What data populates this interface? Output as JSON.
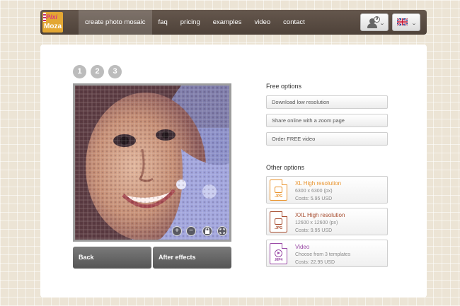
{
  "header": {
    "logo_top": "Pixi",
    "logo_bottom": "Moza",
    "nav": [
      "create photo mosaic",
      "faq",
      "pricing",
      "examples",
      "video",
      "contact"
    ],
    "user_badge": "0",
    "user_chevron": "⌄",
    "lang_chevron": "⌄"
  },
  "steps": [
    "1",
    "2",
    "3"
  ],
  "mosaic_controls": {
    "zoom_in": "+",
    "zoom_out": "−"
  },
  "buttons": {
    "back": "Back",
    "after_effects": "After effects"
  },
  "free_options": {
    "heading": "Free options",
    "items": [
      "Download low resolution",
      "Share online with a zoom page",
      "Order FREE video"
    ]
  },
  "other_options": {
    "heading": "Other options",
    "items": [
      {
        "ext": ".JPG",
        "title": "XL High resolution",
        "line1": "6300 x 6300 (px)",
        "line2": "Costs: 5.95 USD",
        "color": "#e9922a"
      },
      {
        "ext": ".JPG",
        "title": "XXL High resolution",
        "line1": "12600 x 12600 (px)",
        "line2": "Costs: 9.95 USD",
        "color": "#a64a2c"
      },
      {
        "ext": ".MP4",
        "title": "Video",
        "line1": "Choose from 3 templates",
        "line2": "Costs: 22.95 USD",
        "color": "#9a4aa6"
      }
    ]
  }
}
